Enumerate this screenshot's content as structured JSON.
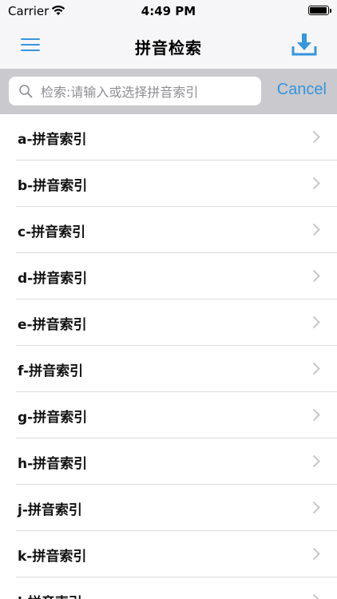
{
  "status_bar": {
    "carrier": "Carrier",
    "time": "4:49 PM"
  },
  "nav": {
    "title": "拼音检索",
    "menu_icon": "hamburger-menu-icon",
    "download_icon": "download-icon"
  },
  "search": {
    "placeholder": "检索:请输入或选择拼音索引",
    "value": "",
    "cancel_label": "Cancel"
  },
  "colors": {
    "accent": "#3796dd",
    "header_bg": "#f6f6f8",
    "search_bar_bg": "#c9c9ce"
  },
  "list": {
    "items": [
      {
        "label": "a-拼音索引"
      },
      {
        "label": "b-拼音索引"
      },
      {
        "label": "c-拼音索引"
      },
      {
        "label": "d-拼音索引"
      },
      {
        "label": "e-拼音索引"
      },
      {
        "label": "f-拼音索引"
      },
      {
        "label": "g-拼音索引"
      },
      {
        "label": "h-拼音索引"
      },
      {
        "label": "j-拼音索引"
      },
      {
        "label": "k-拼音索引"
      },
      {
        "label": "l-拼音索引"
      }
    ]
  }
}
